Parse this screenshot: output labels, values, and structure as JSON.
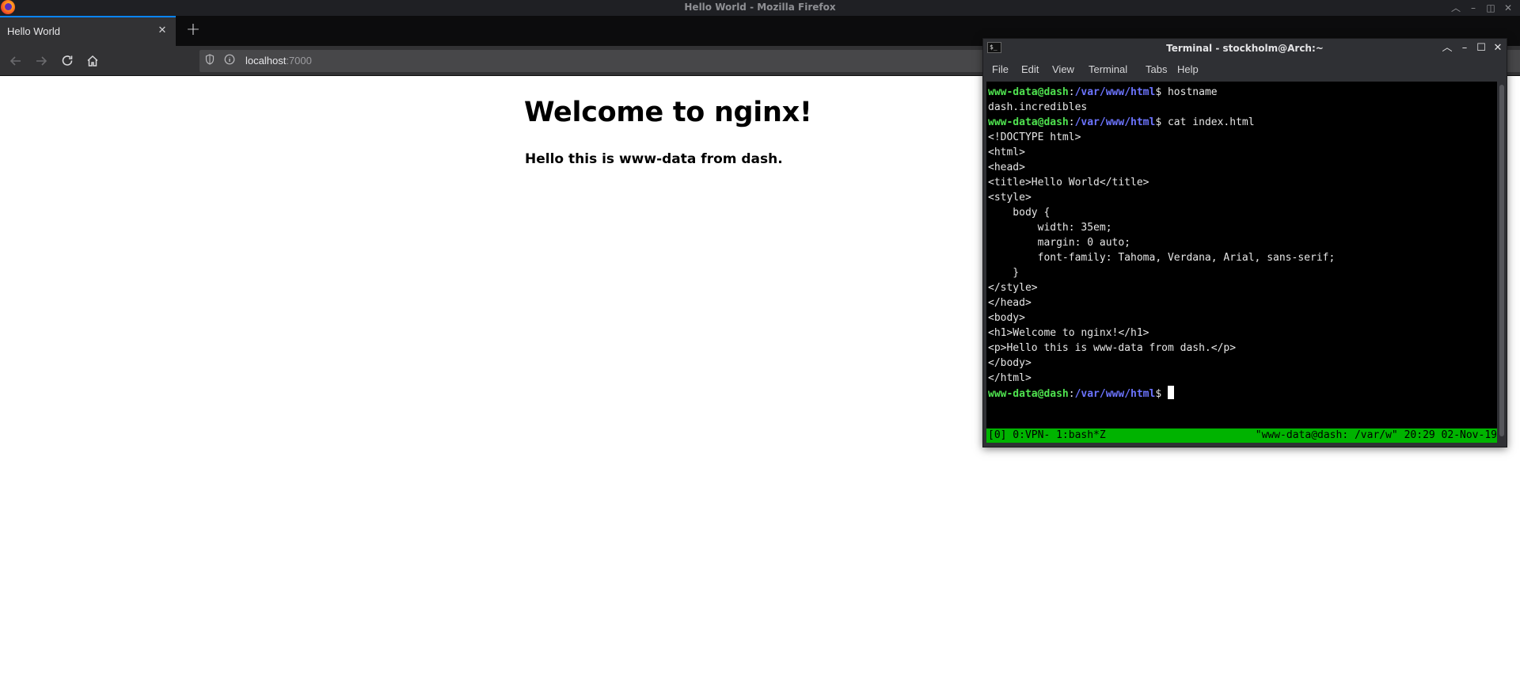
{
  "firefox": {
    "window_title": "Hello World - Mozilla Firefox",
    "tab": {
      "title": "Hello World",
      "close_glyph": "✕"
    },
    "new_tab_glyph": "+",
    "url": {
      "host": "localhost",
      "port": ":7000"
    },
    "page": {
      "heading": "Welcome to nginx!",
      "paragraph": "Hello this is www-data from dash."
    }
  },
  "terminal": {
    "title": "Terminal - stockholm@Arch:~",
    "menu": [
      "File",
      "Edit",
      "View",
      "Terminal",
      "Tabs",
      "Help"
    ],
    "prompt": {
      "user_host": "www-data@dash",
      "colon": ":",
      "path": "/var/www/html",
      "dollar": "$ "
    },
    "lines": [
      {
        "kind": "cmd",
        "text": "hostname"
      },
      {
        "kind": "out",
        "text": "dash.incredibles"
      },
      {
        "kind": "cmd",
        "text": "cat index.html"
      },
      {
        "kind": "out",
        "text": "<!DOCTYPE html>"
      },
      {
        "kind": "out",
        "text": "<html>"
      },
      {
        "kind": "out",
        "text": "<head>"
      },
      {
        "kind": "out",
        "text": "<title>Hello World</title>"
      },
      {
        "kind": "out",
        "text": "<style>"
      },
      {
        "kind": "out",
        "text": "    body {"
      },
      {
        "kind": "out",
        "text": "        width: 35em;"
      },
      {
        "kind": "out",
        "text": "        margin: 0 auto;"
      },
      {
        "kind": "out",
        "text": "        font-family: Tahoma, Verdana, Arial, sans-serif;"
      },
      {
        "kind": "out",
        "text": "    }"
      },
      {
        "kind": "out",
        "text": "</style>"
      },
      {
        "kind": "out",
        "text": "</head>"
      },
      {
        "kind": "out",
        "text": "<body>"
      },
      {
        "kind": "out",
        "text": "<h1>Welcome to nginx!</h1>"
      },
      {
        "kind": "out",
        "text": "<p>Hello this is www-data from dash.</p>"
      },
      {
        "kind": "out",
        "text": "</body>"
      },
      {
        "kind": "out",
        "text": "</html>"
      },
      {
        "kind": "cmd",
        "text": ""
      }
    ],
    "tmux": {
      "left": "[0] 0:VPN- 1:bash*Z",
      "right": "\"www-data@dash: /var/w\" 20:29 02-Nov-19"
    }
  },
  "colors": {
    "prompt_user": "#4fe34f",
    "prompt_path": "#6c74ff",
    "tmux_bar": "#00b300",
    "tab_accent": "#0a84ff"
  }
}
